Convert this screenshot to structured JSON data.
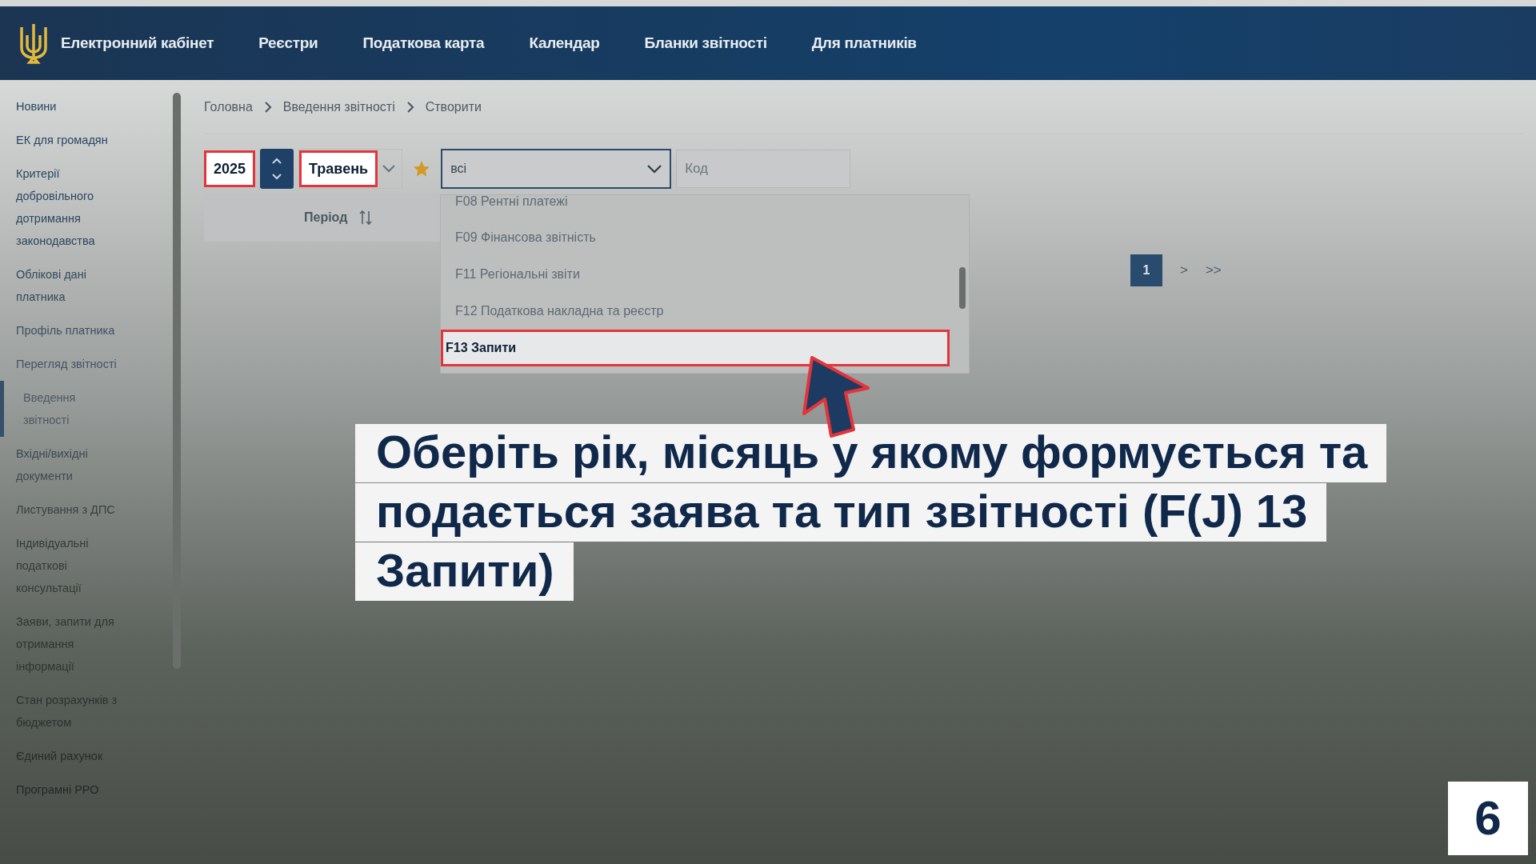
{
  "header": {
    "title": "Електронний кабінет",
    "nav": [
      "Реєстри",
      "Податкова карта",
      "Календар",
      "Бланки звітності",
      "Для платників"
    ]
  },
  "sidebar": {
    "items": [
      {
        "label": "Новини",
        "selected": false
      },
      {
        "label": "ЕК для громадян",
        "selected": false
      },
      {
        "label": "Критерії добровільного дотримання законодавства",
        "selected": false
      },
      {
        "label": "Облікові дані платника",
        "selected": false
      },
      {
        "label": "Профіль платника",
        "selected": false
      },
      {
        "label": "Перегляд звітності",
        "selected": false
      },
      {
        "label": "Введення звітності",
        "selected": true
      },
      {
        "label": "Вхідні/вихідні документи",
        "selected": false
      },
      {
        "label": "Листування з ДПС",
        "selected": false
      },
      {
        "label": "Індивідуальні податкові консультації",
        "selected": false
      },
      {
        "label": "Заяви, запити для отримання інформації",
        "selected": false
      },
      {
        "label": "Стан розрахунків з бюджетом",
        "selected": false
      },
      {
        "label": "Єдиний рахунок",
        "selected": false
      },
      {
        "label": "Програмні РРО",
        "selected": false
      }
    ]
  },
  "breadcrumb": [
    "Головна",
    "Введення звітності",
    "Створити"
  ],
  "filters": {
    "year": {
      "value": "2025",
      "highlighted": true
    },
    "month": {
      "value": "Травень",
      "highlighted": true
    },
    "report_type": "всі",
    "code": {
      "placeholder": "Код"
    }
  },
  "dropdown": {
    "items": [
      {
        "label": "F08 Рентні платежі",
        "selected": false,
        "highlighted": false
      },
      {
        "label": "F09 Фінансова звітність",
        "selected": false,
        "highlighted": false
      },
      {
        "label": "F11 Регіональні звіти",
        "selected": false,
        "highlighted": false
      },
      {
        "label": "F12 Податкова накладна та реєстр",
        "selected": false,
        "highlighted": false
      },
      {
        "label": "F13 Запити",
        "selected": true,
        "highlighted": true
      }
    ]
  },
  "table": {
    "columns": [
      "Період"
    ]
  },
  "pagination": {
    "pages": [
      {
        "label": "1",
        "selected": true
      }
    ],
    "next": ">",
    "last": ">>"
  },
  "callout": "Оберіть рік, місяць у якому формується та подається заява та тип звітності (F(J) 13 Запити)",
  "step": "6"
}
